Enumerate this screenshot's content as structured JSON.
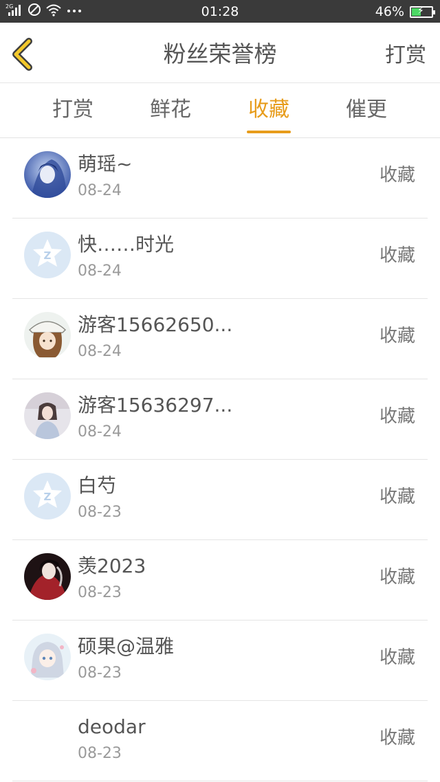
{
  "status_bar": {
    "network": "2G",
    "time": "01:28",
    "battery": "46%",
    "battery_level": 0.46
  },
  "header": {
    "title": "粉丝荣誉榜",
    "right_label": "打赏"
  },
  "tabs": [
    {
      "label": "打赏"
    },
    {
      "label": "鲜花"
    },
    {
      "label": "收藏",
      "active": true
    },
    {
      "label": "催更"
    }
  ],
  "colors": {
    "accent": "#e79c1b",
    "status_bar": "#3a3a3a",
    "battery_fill": "#4cd964"
  },
  "list": [
    {
      "name": "萌瑶~",
      "date": "08-24",
      "action": "收藏",
      "avatar": "anime-blue-avatar"
    },
    {
      "name": "快……时光",
      "date": "08-24",
      "action": "收藏",
      "avatar": "default-qq-avatar"
    },
    {
      "name": "游客15662650...",
      "date": "08-24",
      "action": "收藏",
      "avatar": "anime-girl-hat-avatar"
    },
    {
      "name": "游客15636297...",
      "date": "08-24",
      "action": "收藏",
      "avatar": "photo-girl-avatar"
    },
    {
      "name": "白芍",
      "date": "08-23",
      "action": "收藏",
      "avatar": "default-qq-avatar"
    },
    {
      "name": "羡2023",
      "date": "08-23",
      "action": "收藏",
      "avatar": "dark-red-anime-avatar"
    },
    {
      "name": "硕果@温雅",
      "date": "08-23",
      "action": "收藏",
      "avatar": "pastel-anime-avatar"
    },
    {
      "name": "deodar",
      "date": "08-23",
      "action": "收藏",
      "avatar": "blank-avatar"
    }
  ]
}
